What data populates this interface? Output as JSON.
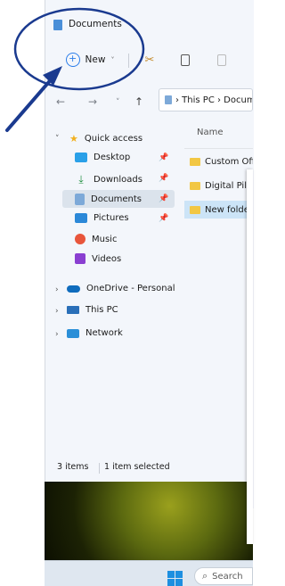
{
  "window": {
    "title": "Documents"
  },
  "ribbon": {
    "new_label": "New",
    "new_chevron": "˅"
  },
  "nav": {
    "address_path": "› This PC › Documents"
  },
  "sidebar": {
    "quick_access": "Quick access",
    "items": [
      {
        "label": "Desktop",
        "icon": "desktop-icon",
        "color": "#2aa0e8",
        "pinned": true
      },
      {
        "label": "Downloads",
        "icon": "download-icon",
        "color": "#1e8e3e",
        "pinned": true
      },
      {
        "label": "Documents",
        "icon": "documents-icon",
        "color": "#7da9d8",
        "pinned": true,
        "selected": true
      },
      {
        "label": "Pictures",
        "icon": "pictures-icon",
        "color": "#2b88d8",
        "pinned": true
      },
      {
        "label": "Music",
        "icon": "music-icon",
        "color": "#e8553b"
      },
      {
        "label": "Videos",
        "icon": "videos-icon",
        "color": "#8a3fd1"
      }
    ],
    "onedrive": "OneDrive - Personal",
    "this_pc": "This PC",
    "network": "Network"
  },
  "content": {
    "column_name": "Name",
    "files": [
      {
        "label": "Custom Office Templates"
      },
      {
        "label": "Digital Pilot"
      },
      {
        "label": "New folder",
        "selected": true
      }
    ]
  },
  "status": {
    "items": "3 items",
    "selected": "1 item selected"
  },
  "taskbar": {
    "search_placeholder": "Search"
  },
  "colors": {
    "accent": "#2b7de9",
    "annotation": "#1a3a8f",
    "selection": "#cce4f7"
  }
}
